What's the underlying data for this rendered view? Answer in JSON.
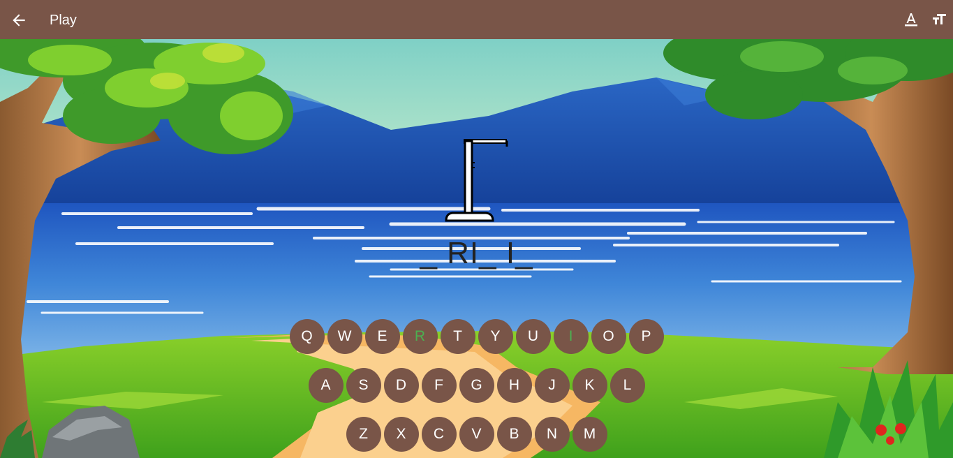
{
  "appbar": {
    "title": "Play",
    "icons": {
      "back": "arrow-back-icon",
      "text_color": "format-color-text-icon",
      "text_size": "format-size-icon"
    }
  },
  "colors": {
    "brand": "#795548",
    "correct_letter": "#4caf50",
    "word_text": "#222222"
  },
  "game": {
    "word_display": "_ RI_ I_",
    "keyboard": {
      "rows": [
        [
          "Q",
          "W",
          "E",
          "R",
          "T",
          "Y",
          "U",
          "I",
          "O",
          "P"
        ],
        [
          "A",
          "S",
          "D",
          "F",
          "G",
          "H",
          "J",
          "K",
          "L"
        ],
        [
          "Z",
          "X",
          "C",
          "V",
          "B",
          "N",
          "M"
        ]
      ],
      "guessed_correct": [
        "R",
        "I"
      ]
    }
  }
}
